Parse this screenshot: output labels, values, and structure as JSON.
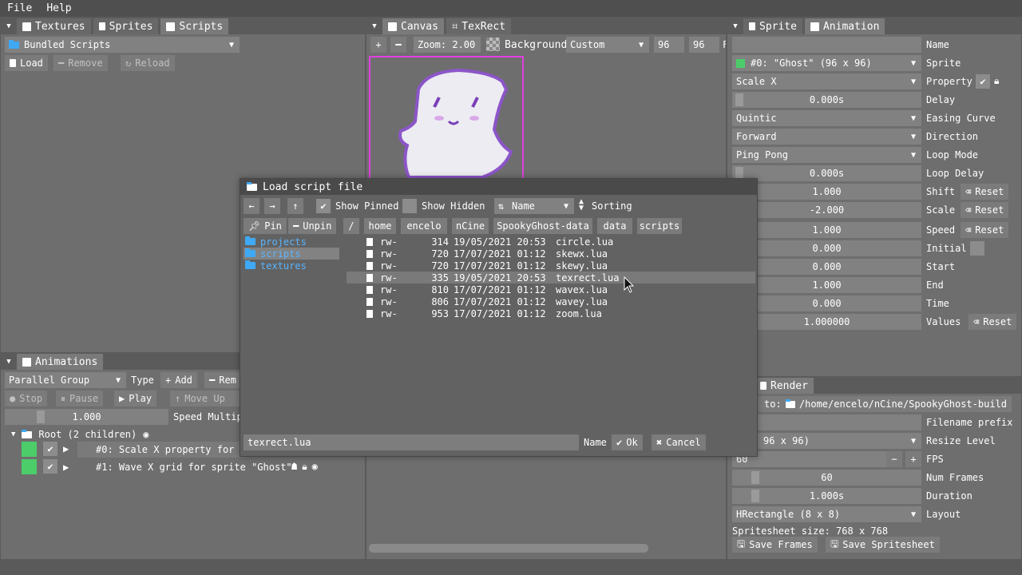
{
  "menu": {
    "file": "File",
    "help": "Help"
  },
  "left_panel": {
    "tabs": [
      "Textures",
      "Sprites",
      "Scripts"
    ],
    "combo_value": "Bundled Scripts",
    "buttons": {
      "load": "Load",
      "remove": "Remove",
      "reload": "Reload"
    }
  },
  "center_panel": {
    "tabs": [
      "Canvas",
      "TexRect"
    ],
    "zoom": "Zoom: 2.00",
    "background_label": "Background",
    "background_value": "Custom",
    "width": "96",
    "height": "96",
    "trailing_label": "F"
  },
  "animations_panel": {
    "title": "Animations",
    "group_type": "Parallel Group",
    "type_label": "Type",
    "add_label": "Add",
    "remove_label": "Rem",
    "stop": "Stop",
    "pause": "Pause",
    "play": "Play",
    "move_up": "Move Up",
    "speed_value": "1.000",
    "speed_label": "Speed Multip",
    "root_label": "Root (2 children)",
    "items": [
      {
        "label": "#0: Scale X property for s"
      },
      {
        "label": "#1: Wave X grid for sprite \"Ghost\""
      }
    ]
  },
  "right_panel": {
    "tabs": [
      "Sprite",
      "Animation"
    ],
    "rows": [
      {
        "kind": "field",
        "value": "",
        "label": "Name"
      },
      {
        "kind": "combo",
        "value": "#0: \"Ghost\" (96 x 96)",
        "label": "Sprite",
        "green": true
      },
      {
        "kind": "combo",
        "value": "Scale X",
        "label": "Property"
      },
      {
        "kind": "slider",
        "value": "0.000s",
        "label": "Delay"
      },
      {
        "kind": "combo",
        "value": "Quintic",
        "label": "Easing Curve"
      },
      {
        "kind": "combo",
        "value": "Forward",
        "label": "Direction"
      },
      {
        "kind": "combo",
        "value": "Ping Pong",
        "label": "Loop Mode"
      },
      {
        "kind": "slider",
        "value": "0.000s",
        "label": "Loop Delay"
      },
      {
        "kind": "slider",
        "value": "1.000",
        "label": "Shift",
        "reset": "Reset"
      },
      {
        "kind": "slider",
        "value": "-2.000",
        "label": "Scale",
        "reset": "Reset"
      },
      {
        "kind": "slider",
        "value": "1.000",
        "label": "Speed",
        "reset": "Reset"
      },
      {
        "kind": "slider",
        "value": "0.000",
        "label": "Initial"
      },
      {
        "kind": "slider",
        "value": "0.000",
        "label": "Start"
      },
      {
        "kind": "slider",
        "value": "1.000",
        "label": "End"
      },
      {
        "kind": "slider",
        "value": "0.000",
        "label": "Time"
      },
      {
        "kind": "slider",
        "value": "1.000000",
        "label": "Values",
        "reset": "Reset"
      }
    ]
  },
  "render_panel": {
    "tab": "Render",
    "save_to": "to:",
    "save_path": "/home/encelo/nCine/SpookyGhost-build",
    "filename_prefix_label": "Filename prefix",
    "resize_value": "96 x 96)",
    "resize_label": "Resize Level",
    "fps_value": "60",
    "fps_label": "FPS",
    "num_frames_value": "60",
    "num_frames_label": "Num Frames",
    "duration_value": "1.000s",
    "duration_label": "Duration",
    "layout_value": "HRectangle (8 x 8)",
    "layout_label": "Layout",
    "spritesheet_size": "Spritesheet size: 768 x 768",
    "save_frames": "Save Frames",
    "save_spritesheet": "Save Spritesheet"
  },
  "dialog": {
    "title": "Load script file",
    "show_pinned": "Show Pinned",
    "show_hidden": "Show Hidden",
    "sort_value": "Name",
    "sorting_label": "Sorting",
    "pin": "Pin",
    "unpin": "Unpin",
    "path": [
      "/",
      "home",
      "encelo",
      "nCine",
      "SpookyGhost-data",
      "data",
      "scripts"
    ],
    "dirs": [
      "projects",
      "scripts",
      "textures"
    ],
    "selected_dir_index": 1,
    "files": [
      {
        "perm": "rw-",
        "size": "314",
        "date": "19/05/2021 20:53",
        "name": "circle.lua"
      },
      {
        "perm": "rw-",
        "size": "720",
        "date": "17/07/2021 01:12",
        "name": "skewx.lua"
      },
      {
        "perm": "rw-",
        "size": "720",
        "date": "17/07/2021 01:12",
        "name": "skewy.lua"
      },
      {
        "perm": "rw-",
        "size": "335",
        "date": "19/05/2021 20:53",
        "name": "texrect.lua"
      },
      {
        "perm": "rw-",
        "size": "810",
        "date": "17/07/2021 01:12",
        "name": "wavex.lua"
      },
      {
        "perm": "rw-",
        "size": "806",
        "date": "17/07/2021 01:12",
        "name": "wavey.lua"
      },
      {
        "perm": "rw-",
        "size": "953",
        "date": "17/07/2021 01:12",
        "name": "zoom.lua"
      }
    ],
    "selected_file_index": 3,
    "filename": "texrect.lua",
    "name_label": "Name",
    "ok": "Ok",
    "cancel": "Cancel"
  },
  "colors": {
    "accent_green": "#4ccd6a",
    "folder_blue": "#3fa9f5",
    "frame_magenta": "#e040e0"
  }
}
